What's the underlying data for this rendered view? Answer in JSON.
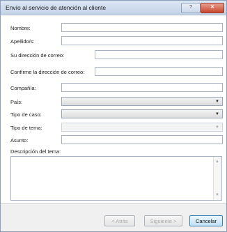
{
  "window": {
    "title": "Envío al servicio de atención al cliente",
    "help": "?",
    "close": "✕"
  },
  "form": {
    "nombre_label": "Nombre:",
    "apellidos_label": "Apellido/s:",
    "email_label": "Su dirección de correo:",
    "confirm_email_label": "Confirme la dirección de correo:",
    "compania_label": "Compañía:",
    "pais_label": "País:",
    "tipo_caso_label": "Tipo de caso:",
    "tipo_tema_label": "Tipo de tema:",
    "asunto_label": "Asunto:",
    "descripcion_label": "Descripción del tema:",
    "nombre": "",
    "apellidos": "",
    "email": "",
    "confirm_email": "",
    "compania": "",
    "asunto": ""
  },
  "buttons": {
    "back": "< Atrás",
    "next": "Siguiente >",
    "cancel": "Cancelar"
  }
}
